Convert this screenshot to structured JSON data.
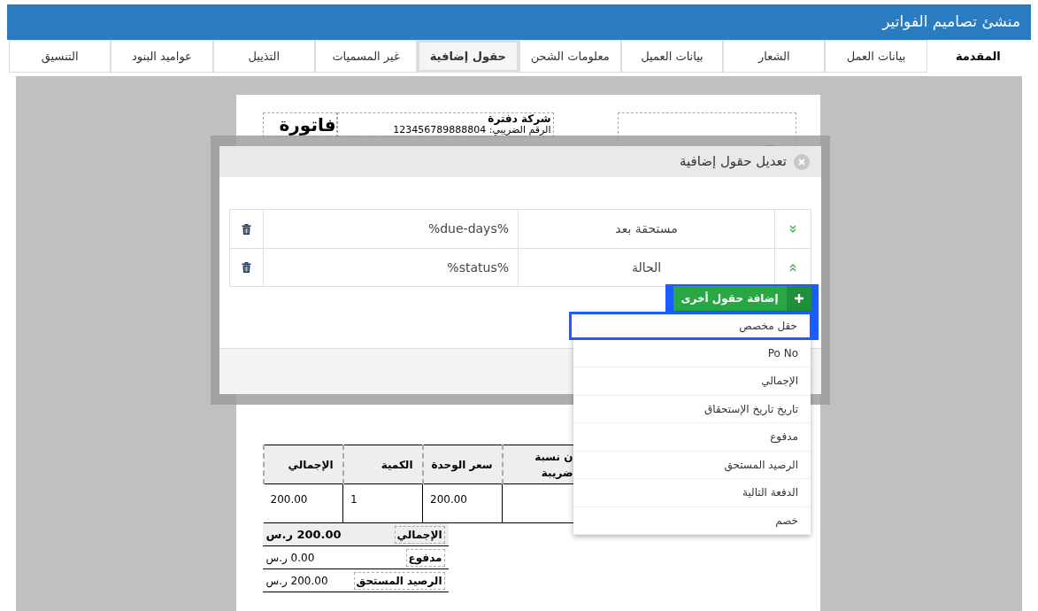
{
  "window": {
    "title": "منشئ تصاميم الفواتير"
  },
  "tabs": [
    {
      "label": "المقدمة",
      "selected": true,
      "focused": false
    },
    {
      "label": "بيانات العمل",
      "selected": false,
      "focused": false
    },
    {
      "label": "الشعار",
      "selected": false,
      "focused": false
    },
    {
      "label": "بيانات العميل",
      "selected": false,
      "focused": false
    },
    {
      "label": "معلومات الشحن",
      "selected": false,
      "focused": false
    },
    {
      "label": "حقول إضافية",
      "selected": false,
      "focused": true
    },
    {
      "label": "غير المسميات",
      "selected": false,
      "focused": false
    },
    {
      "label": "التذييل",
      "selected": false,
      "focused": false
    },
    {
      "label": "عواميد البنود",
      "selected": false,
      "focused": false
    },
    {
      "label": "التنسيق",
      "selected": false,
      "focused": false
    }
  ],
  "invoice": {
    "title": "فاتورة",
    "company": "شركة دفترة",
    "tax_label": "الرقم الضريبي:",
    "tax_number": "123456789888804",
    "columns": [
      "ن نسبة ضريبة",
      "سعر الوحدة",
      "الكمية",
      "الإجمالي"
    ],
    "rows": [
      [
        "",
        "200.00",
        "1",
        "200.00"
      ]
    ],
    "totals": [
      {
        "label": "الإجمالي",
        "value": "200.00 ر.س",
        "highlighted": true
      },
      {
        "label": "مدفوع",
        "value": "0.00 ر.س",
        "highlighted": false
      },
      {
        "label": "الرصيد المستحق",
        "value": "200.00 ر.س",
        "highlighted": false
      }
    ]
  },
  "dialog": {
    "title": "تعديل حقول إضافية",
    "fields": [
      {
        "label": "مستحقة بعد",
        "value": "%due-days%",
        "kind": "down"
      },
      {
        "label": "الحالة",
        "value": "%status%",
        "kind": "up"
      }
    ],
    "add_button": {
      "label": "إضافة حقول أخرى",
      "focused": true
    },
    "menu": [
      {
        "label": "حقل مخصص",
        "focused": true
      },
      {
        "label": "Po No",
        "focused": false
      },
      {
        "label": "الإجمالي",
        "focused": false
      },
      {
        "label": "تاريخ تاريخ الإستحقاق",
        "focused": false
      },
      {
        "label": "مدفوع",
        "focused": false
      },
      {
        "label": "الرصيد المستحق",
        "focused": false
      },
      {
        "label": "الدفعة التالية",
        "focused": false
      },
      {
        "label": "خصم",
        "focused": false
      }
    ]
  }
}
